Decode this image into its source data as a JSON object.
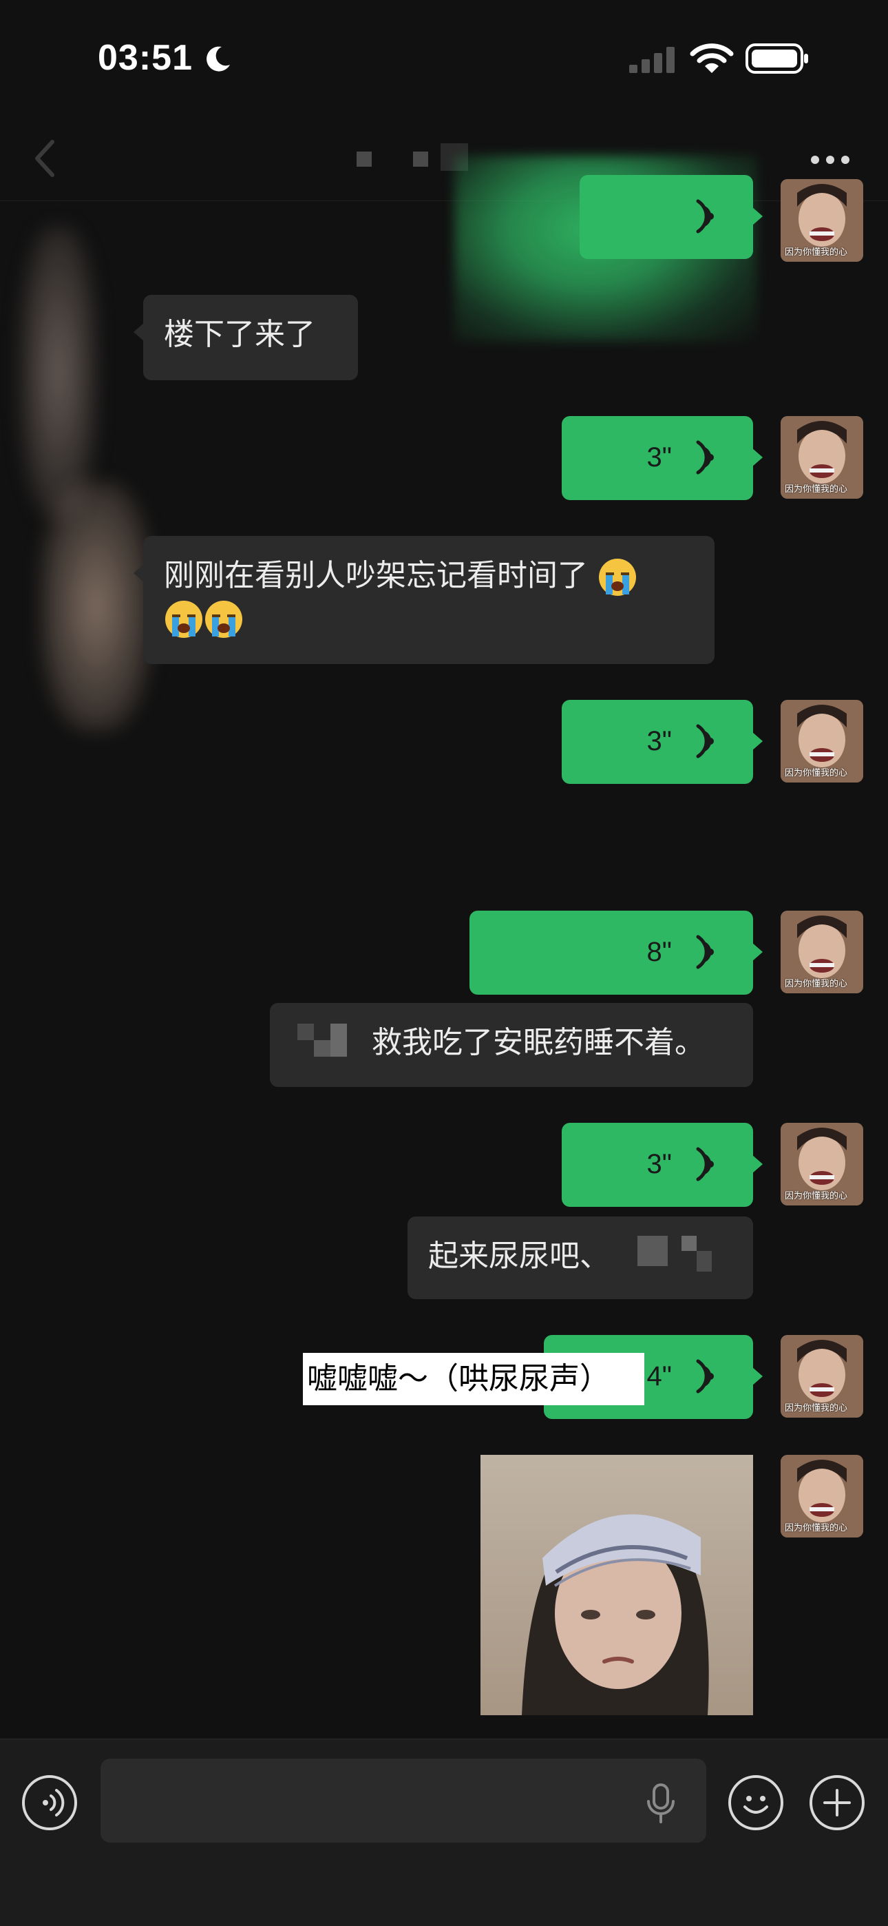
{
  "status_bar": {
    "time": "03:51"
  },
  "header": {
    "back_icon": "chevron-left-icon",
    "more_icon": "ellipsis-icon"
  },
  "avatar_caption": "因为你懂我的心",
  "messages": [
    {
      "side": "right",
      "type": "voice",
      "duration": ""
    },
    {
      "side": "left",
      "type": "text",
      "text": "楼下了来了"
    },
    {
      "side": "right",
      "type": "voice",
      "duration": "3\""
    },
    {
      "side": "left",
      "type": "text",
      "text": "刚刚在看别人吵架忘记看时间了"
    },
    {
      "side": "right",
      "type": "voice",
      "duration": "3\""
    },
    {
      "side": "right",
      "type": "voice",
      "duration": "8\""
    },
    {
      "side": "left",
      "type": "text",
      "text": "救我吃了安眠药睡不着。"
    },
    {
      "side": "right",
      "type": "voice",
      "duration": "3\""
    },
    {
      "side": "left",
      "type": "text",
      "text": "起来尿尿吧、"
    },
    {
      "side": "right",
      "type": "voice",
      "duration": "4\""
    },
    {
      "side": "right",
      "type": "sticker"
    }
  ],
  "caption_overlay": "嘘嘘嘘～（哄尿尿声）",
  "input": {
    "placeholder": ""
  },
  "colors": {
    "background": "#111111",
    "sent_bubble": "#2fb864",
    "received_bubble": "#2b2b2b"
  }
}
